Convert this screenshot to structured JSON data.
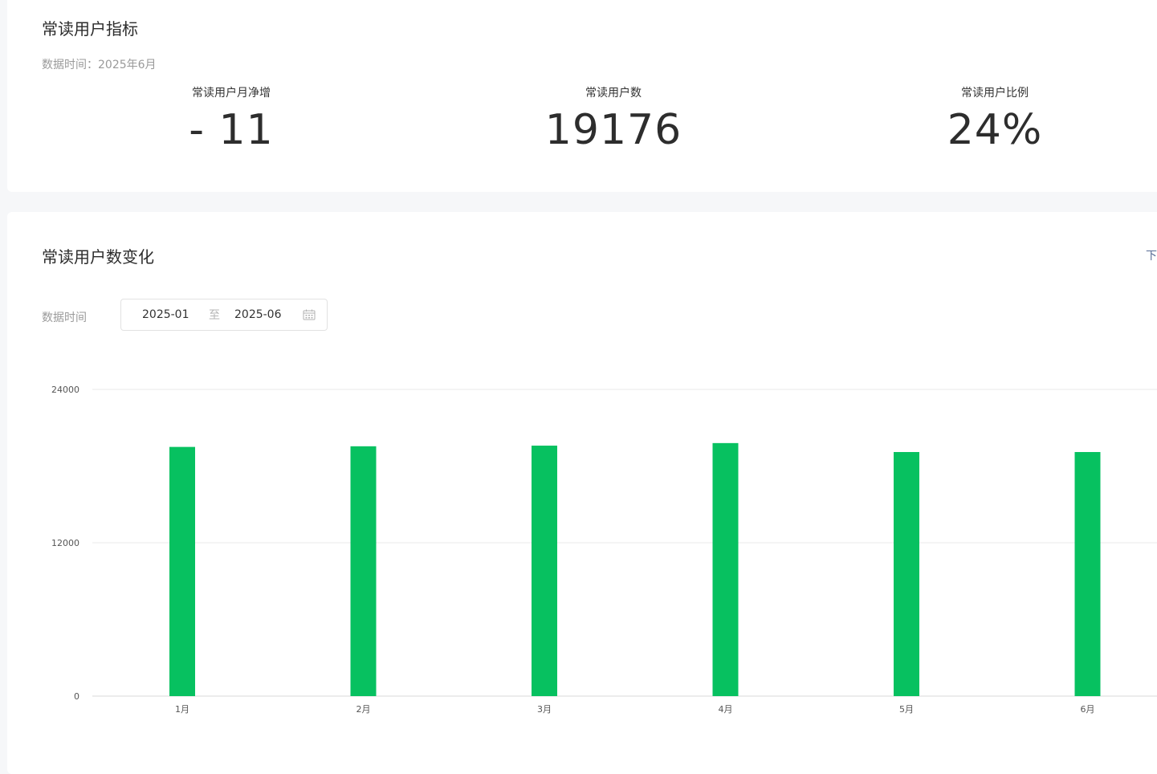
{
  "metrics_card": {
    "title": "常读用户指标",
    "data_time": "数据时间：2025年6月",
    "items": [
      {
        "label": "常读用户月净增",
        "value": "- 11"
      },
      {
        "label": "常读用户数",
        "value": "19176"
      },
      {
        "label": "常读用户比例",
        "value": "24%"
      }
    ]
  },
  "trend_card": {
    "title": "常读用户数变化",
    "download_label": "下载",
    "filter_label": "数据时间",
    "date_start": "2025-01",
    "date_separator": "至",
    "date_end": "2025-06",
    "calendar_icon": "calendar-icon"
  },
  "colors": {
    "bar": "#07c160",
    "grid": "#e8e8e8",
    "link": "#576b95"
  },
  "chart_data": {
    "type": "bar",
    "categories": [
      "1月",
      "2月",
      "3月",
      "4月",
      "5月",
      "6月"
    ],
    "values": [
      19500,
      19550,
      19600,
      19800,
      19100,
      19100
    ],
    "yticks": [
      0,
      12000,
      24000
    ],
    "ylim": [
      0,
      24000
    ],
    "grid": true
  }
}
